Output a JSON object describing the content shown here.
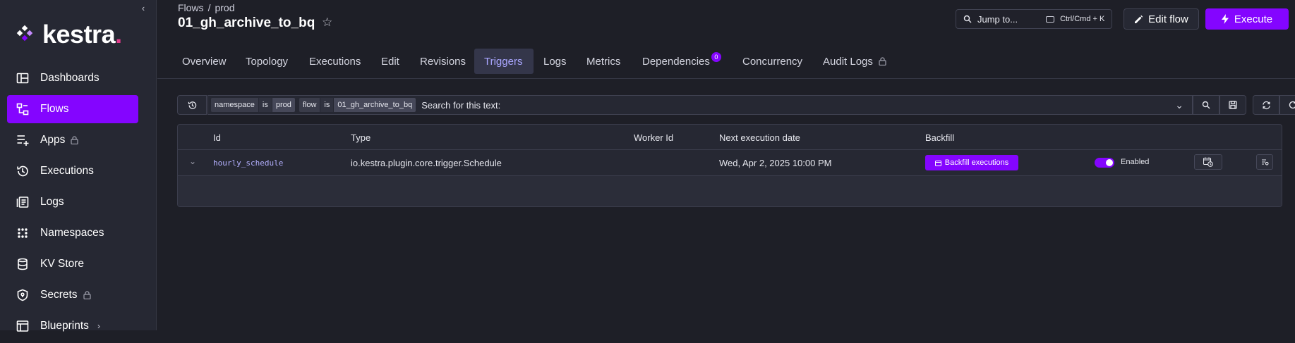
{
  "sidebar": {
    "logo_text": "kestra",
    "items": [
      {
        "label": "Dashboards",
        "icon": "dashboard-icon",
        "active": false,
        "locked": false
      },
      {
        "label": "Flows",
        "icon": "flows-icon",
        "active": true,
        "locked": false
      },
      {
        "label": "Apps",
        "icon": "apps-icon",
        "active": false,
        "locked": true
      },
      {
        "label": "Executions",
        "icon": "history-icon",
        "active": false,
        "locked": false
      },
      {
        "label": "Logs",
        "icon": "logs-icon",
        "active": false,
        "locked": false
      },
      {
        "label": "Namespaces",
        "icon": "namespaces-icon",
        "active": false,
        "locked": false
      },
      {
        "label": "KV Store",
        "icon": "database-icon",
        "active": false,
        "locked": false
      },
      {
        "label": "Secrets",
        "icon": "shield-icon",
        "active": false,
        "locked": true
      },
      {
        "label": "Blueprints",
        "icon": "blueprints-icon",
        "active": false,
        "locked": false,
        "has_chevron": true
      }
    ]
  },
  "header": {
    "breadcrumb": [
      "Flows",
      "prod"
    ],
    "title": "01_gh_archive_to_bq",
    "jump_label": "Jump to...",
    "jump_shortcut": "Ctrl/Cmd + K",
    "edit_label": "Edit flow",
    "execute_label": "Execute"
  },
  "tabs": [
    {
      "label": "Overview"
    },
    {
      "label": "Topology"
    },
    {
      "label": "Executions"
    },
    {
      "label": "Edit"
    },
    {
      "label": "Revisions"
    },
    {
      "label": "Triggers",
      "active": true
    },
    {
      "label": "Logs"
    },
    {
      "label": "Metrics"
    },
    {
      "label": "Dependencies",
      "badge": "0"
    },
    {
      "label": "Concurrency"
    },
    {
      "label": "Audit Logs",
      "locked": true
    }
  ],
  "filters": {
    "chips": [
      {
        "key": "namespace",
        "op": "is",
        "value": "prod"
      },
      {
        "key": "flow",
        "op": "is",
        "value": "01_gh_archive_to_bq"
      }
    ],
    "search_label": "Search for this text:"
  },
  "table": {
    "columns": [
      "Id",
      "Type",
      "Worker Id",
      "Next execution date",
      "Backfill"
    ],
    "rows": [
      {
        "id": "hourly_schedule",
        "type": "io.kestra.plugin.core.trigger.Schedule",
        "worker_id": "",
        "next_execution": "Wed, Apr 2, 2025 10:00 PM",
        "backfill_label": "Backfill executions",
        "enabled_label": "Enabled",
        "enabled": true
      }
    ]
  },
  "colors": {
    "accent": "#8405ff",
    "background": "#1e1f27",
    "sidebar": "#262833",
    "active_tab_text": "#a9a6ff"
  }
}
